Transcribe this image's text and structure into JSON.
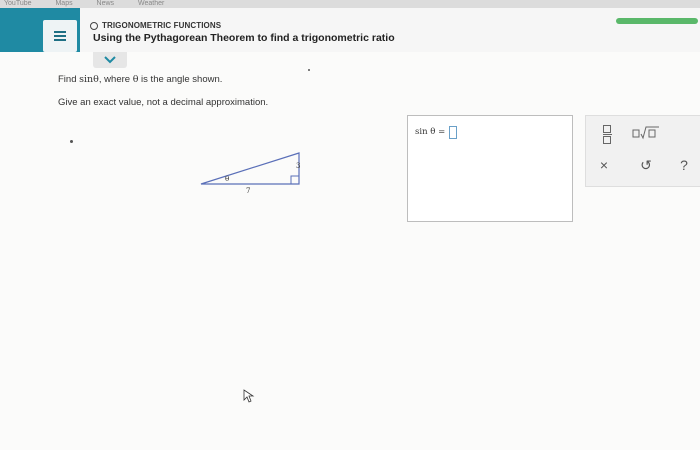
{
  "browser_tabs": [
    "YouTube",
    "Maps",
    "News",
    "Weather"
  ],
  "header": {
    "topic": "TRIGONOMETRIC FUNCTIONS",
    "title": "Using the Pythagorean Theorem to find a trigonometric ratio",
    "progress_color": "#5ab86a",
    "accent_color": "#1f8aa3"
  },
  "question": {
    "prompt_prefix": "Find ",
    "prompt_math": "sinθ",
    "prompt_middle": ", where ",
    "prompt_theta": "θ",
    "prompt_suffix": " is the angle shown.",
    "instruction": "Give an exact value, not a decimal approximation."
  },
  "triangle": {
    "angle_label": "θ",
    "base_label": "7",
    "side_label": "3"
  },
  "answer": {
    "label": "sin θ =",
    "value": ""
  },
  "tools": {
    "fraction": "fraction-icon",
    "sqrt": "sqrt-icon",
    "clear": "×",
    "undo": "↺",
    "help": "?"
  }
}
